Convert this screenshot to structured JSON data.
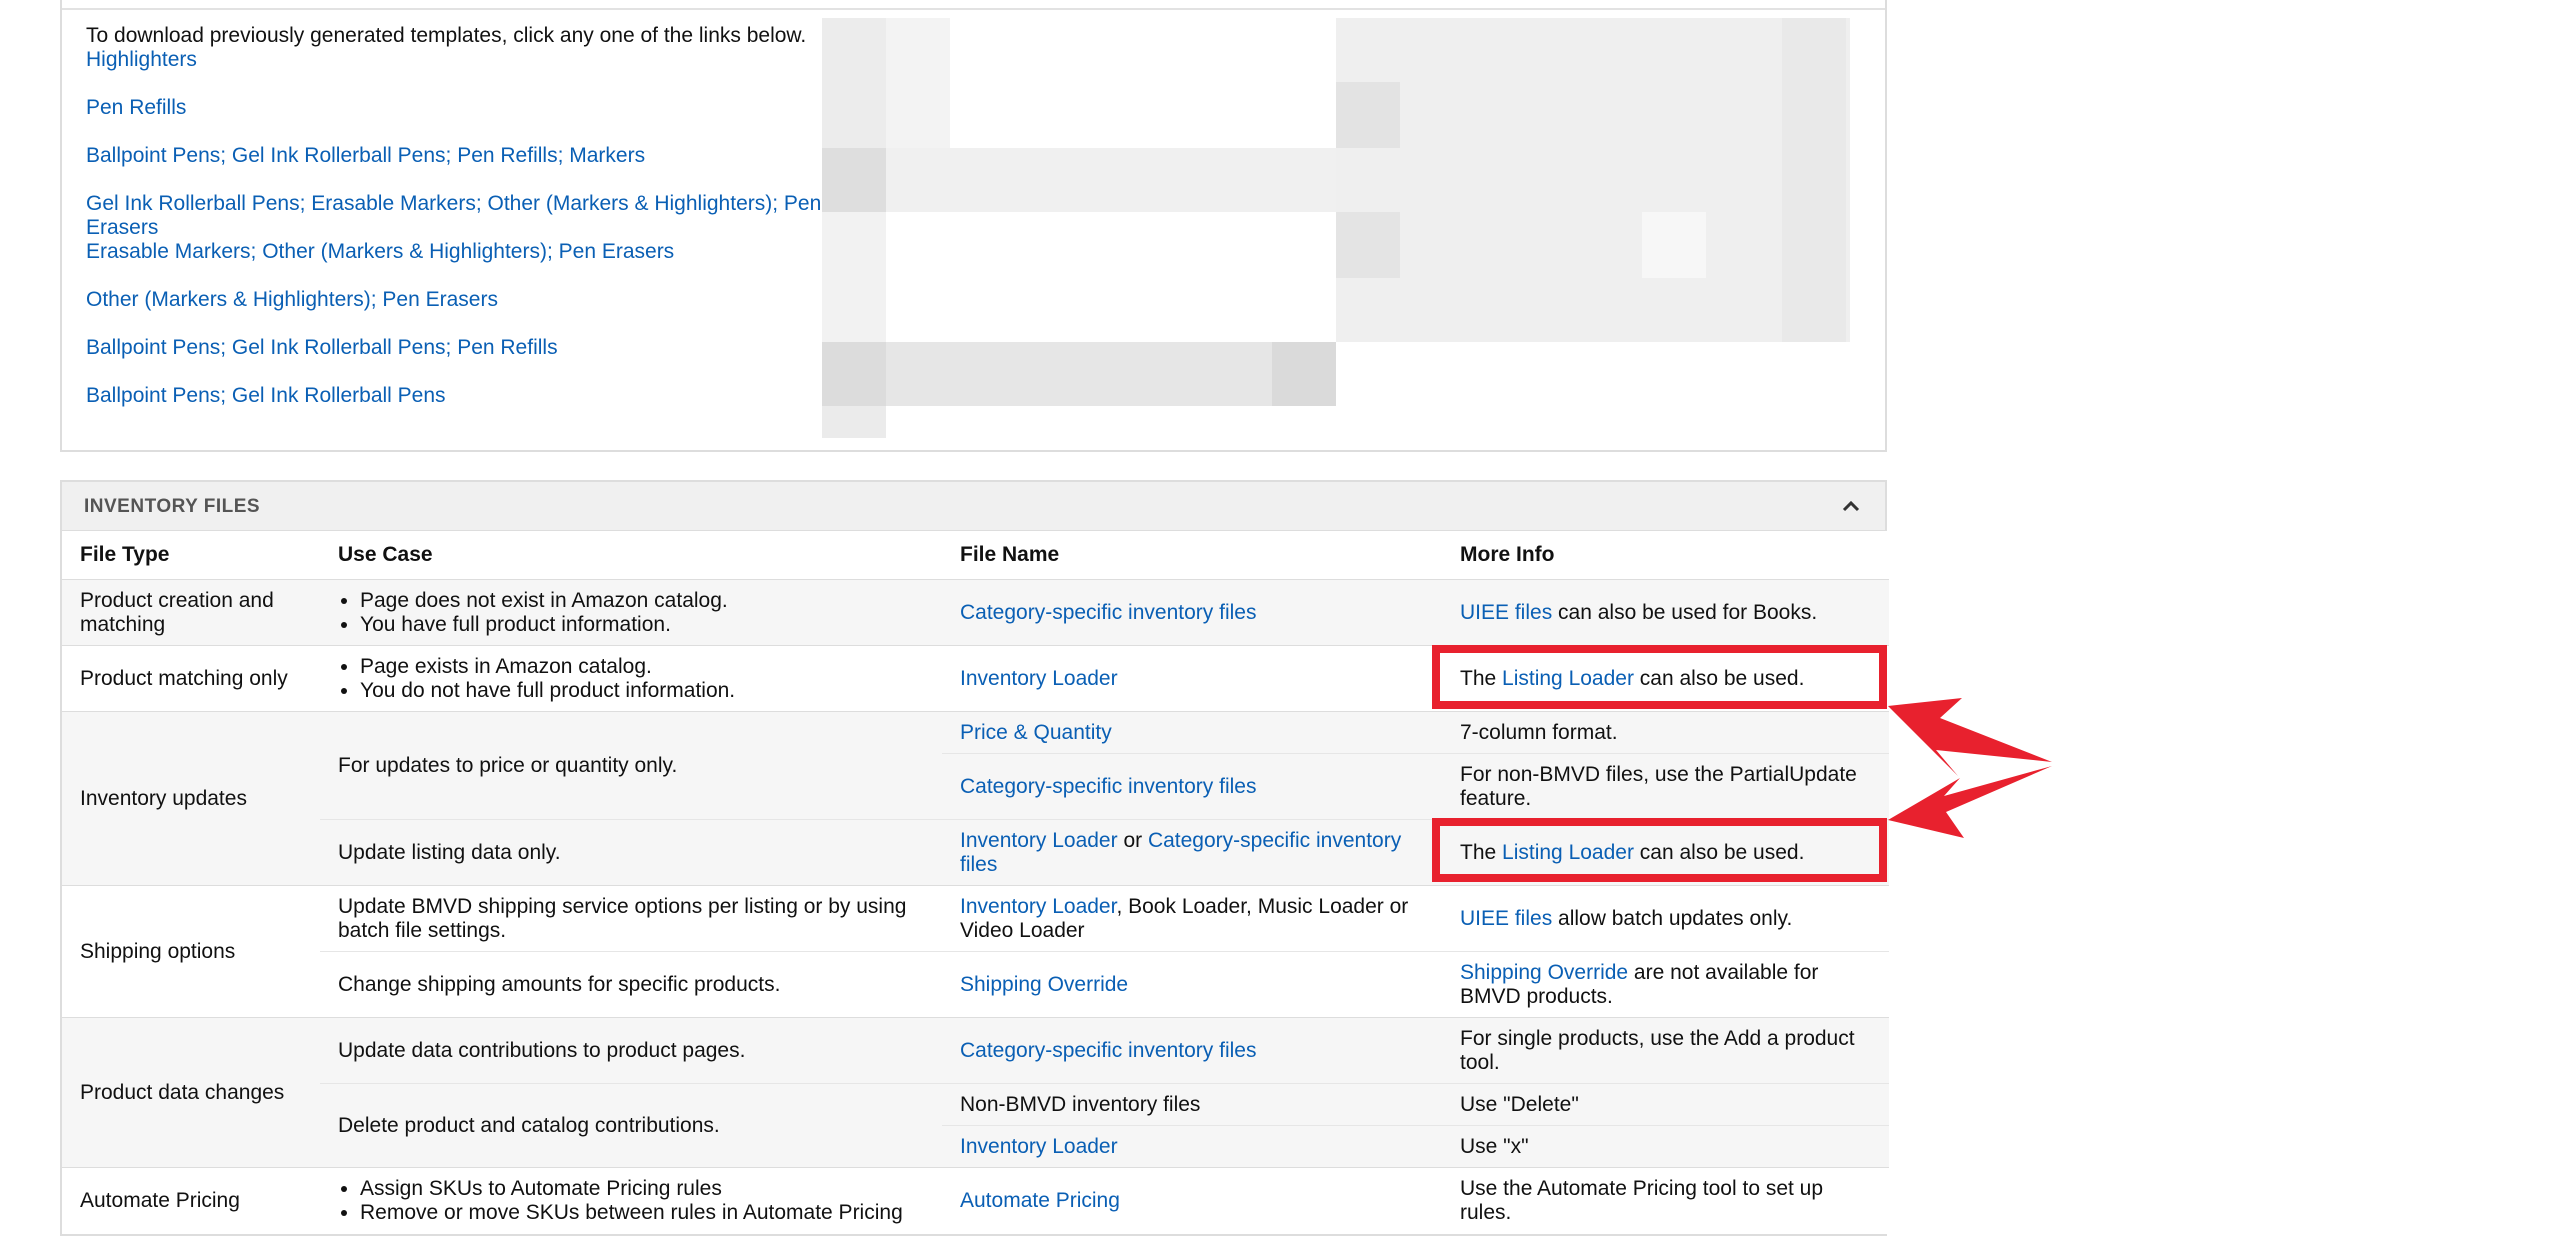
{
  "templates": {
    "intro": "To download previously generated templates, click any one of the links below.",
    "links": [
      "Highlighters",
      "Pen Refills",
      "Ballpoint Pens; Gel Ink Rollerball Pens; Pen Refills; Markers",
      "Gel Ink Rollerball Pens; Erasable Markers; Other (Markers & Highlighters); Pen Erasers",
      "Erasable Markers; Other (Markers & Highlighters); Pen Erasers",
      "Other (Markers & Highlighters); Pen Erasers",
      "Ballpoint Pens; Gel Ink Rollerball Pens; Pen Refills",
      "Ballpoint Pens; Gel Ink Rollerball Pens"
    ]
  },
  "inventory": {
    "title": "INVENTORY FILES",
    "collapse_icon": "chevron-up-icon",
    "headers": {
      "file_type": "File Type",
      "use_case": "Use Case",
      "file_name": "File Name",
      "more_info": "More Info"
    },
    "rows": {
      "creation": {
        "type": "Product creation and matching",
        "use": [
          "Page does not exist in Amazon catalog.",
          "You have full product information."
        ],
        "file": "Category-specific inventory files",
        "info_link": "UIEE files",
        "info_text": " can also be used for Books."
      },
      "matching": {
        "type": "Product matching only",
        "use": [
          "Page exists in Amazon catalog.",
          "You do not have full product information."
        ],
        "file": "Inventory Loader",
        "info_pre": "The ",
        "info_link": "Listing Loader",
        "info_post": " can also be used."
      },
      "updates": {
        "type": "Inventory updates",
        "price_use": "For updates to price or quantity only.",
        "pq_file": "Price & Quantity",
        "pq_info": "7-column format.",
        "cat_file": "Category-specific inventory files",
        "cat_info": "For non-BMVD files, use the PartialUpdate feature.",
        "listing_use": "Update listing data only.",
        "listing_file_a": "Inventory Loader",
        "listing_or": " or ",
        "listing_file_b": "Category-specific inventory files",
        "listing_info_pre": "The ",
        "listing_info_link": "Listing Loader",
        "listing_info_post": " can also be used."
      },
      "shipping": {
        "type": "Shipping options",
        "bmvd_use": "Update BMVD shipping service options per listing or by using batch file settings.",
        "bmvd_file_link": "Inventory Loader",
        "bmvd_file_text": ", Book Loader, Music Loader or Video Loader",
        "bmvd_info_link": "UIEE files",
        "bmvd_info_text": " allow batch updates only.",
        "amt_use": "Change shipping amounts for specific products.",
        "amt_file": "Shipping Override",
        "amt_info_link": "Shipping Override",
        "amt_info_text": " are not available for BMVD products."
      },
      "data_changes": {
        "type": "Product data changes",
        "contrib_use": "Update data contributions to product pages.",
        "contrib_file": "Category-specific inventory files",
        "contrib_info": "For single products, use the Add a product tool.",
        "delete_use": "Delete product and catalog contributions.",
        "nonbmvd_file": "Non-BMVD inventory files",
        "nonbmvd_info": "Use \"Delete\"",
        "loader_file": "Inventory Loader",
        "loader_info": "Use \"x\""
      },
      "pricing": {
        "type": "Automate Pricing",
        "use": [
          "Assign SKUs to Automate Pricing rules",
          "Remove or move SKUs between rules in Automate Pricing"
        ],
        "file": "Automate Pricing",
        "info": "Use the Automate Pricing tool to set up rules."
      }
    }
  },
  "annotation": {
    "highlight_color": "#e8212e"
  }
}
